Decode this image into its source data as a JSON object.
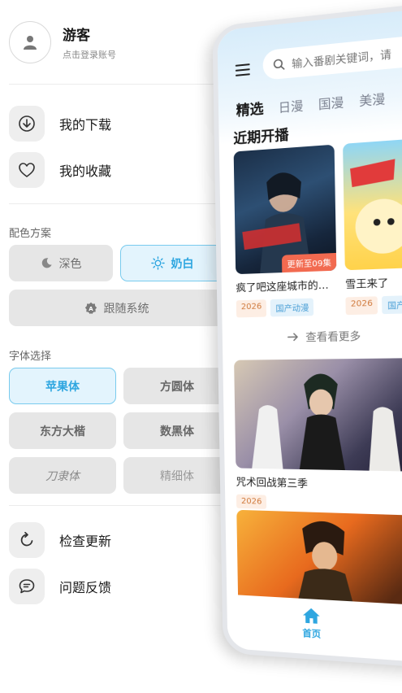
{
  "profile": {
    "name": "游客",
    "subtitle": "点击登录账号"
  },
  "menu": {
    "downloads": "我的下载",
    "favorites": "我的收藏",
    "check_update": "检查更新",
    "feedback": "问题反馈"
  },
  "color_scheme": {
    "title": "配色方案",
    "options": [
      "深色",
      "奶白",
      "跟随系统"
    ],
    "selected": "奶白"
  },
  "font": {
    "title": "字体选择",
    "options": [
      "苹果体",
      "方圆体",
      "东方大楷",
      "数黑体",
      "刀隶体",
      "精细体"
    ],
    "selected": "苹果体"
  },
  "phone": {
    "search_placeholder": "输入番剧关键词，请",
    "tabs": [
      "精选",
      "日漫",
      "国漫",
      "美漫"
    ],
    "active_tab": "精选",
    "section_title": "近期开播",
    "cards": [
      {
        "title": "疯了吧这座城市的…",
        "badge": "更新至09集",
        "year": "2026",
        "category": "国产动漫"
      },
      {
        "title": "雪王来了",
        "year": "2026",
        "category": "国产"
      }
    ],
    "view_more": "查看看更多",
    "feature_cards": [
      {
        "title": "咒术回战第三季",
        "year": "2026"
      }
    ],
    "nav_home": "首页"
  },
  "colors": {
    "accent": "#2ea6e0",
    "accent_bg": "#e3f4fd",
    "chip_bg": "#e6e6e6"
  }
}
